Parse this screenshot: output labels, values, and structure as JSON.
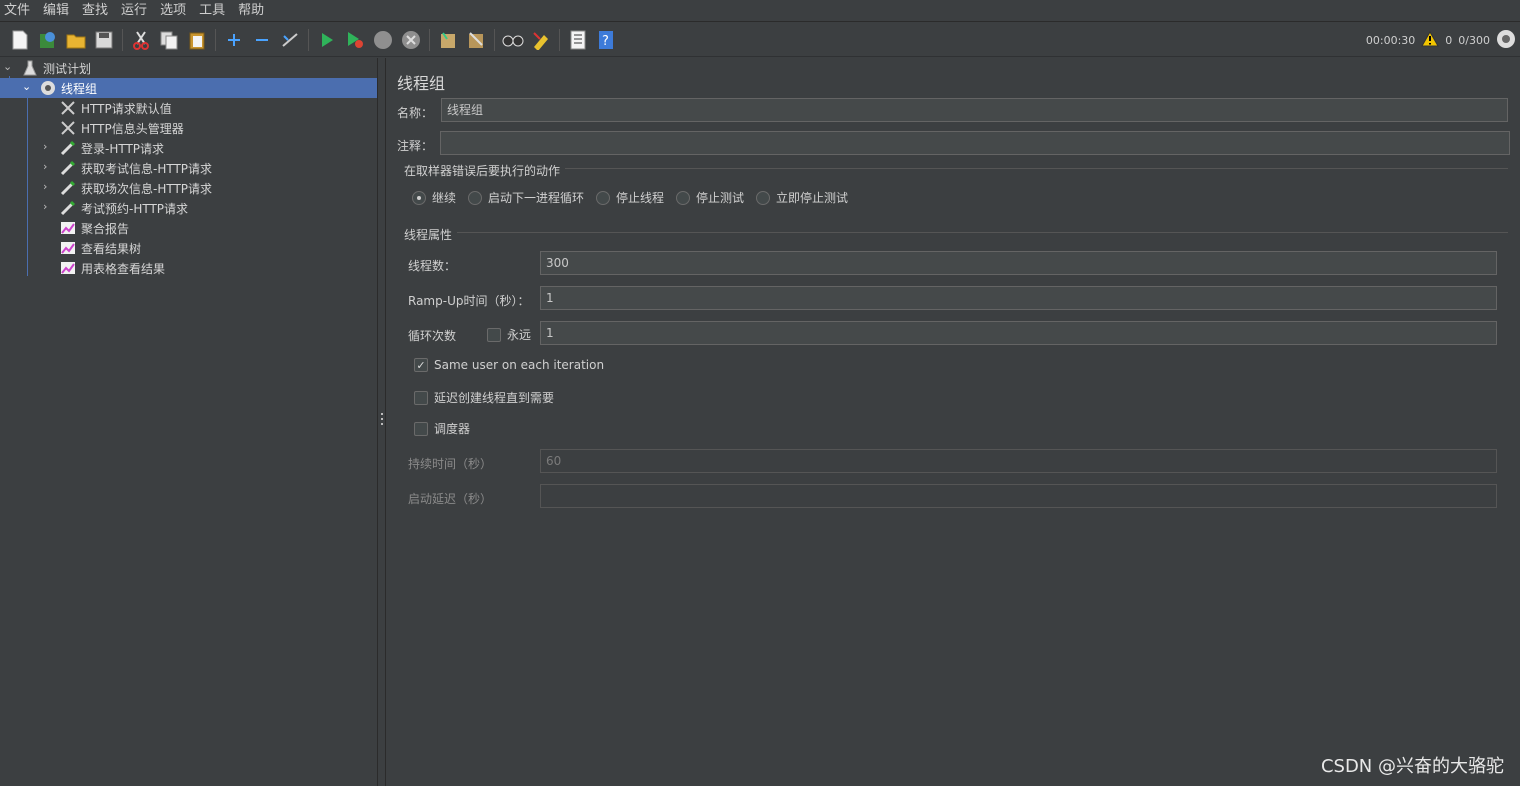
{
  "menu": [
    "文件",
    "编辑",
    "查找",
    "运行",
    "选项",
    "工具",
    "帮助"
  ],
  "status": {
    "elapsed": "00:00:30",
    "warnings": "0",
    "threads": "0/300"
  },
  "tree": {
    "root": "测试计划",
    "group": "线程组",
    "children": [
      "HTTP请求默认值",
      "HTTP信息头管理器",
      "登录-HTTP请求",
      "获取考试信息-HTTP请求",
      "获取场次信息-HTTP请求",
      "考试预约-HTTP请求",
      "聚合报告",
      "查看结果树",
      "用表格查看结果"
    ]
  },
  "panel": {
    "title": "线程组",
    "name_label": "名称：",
    "name_value": "线程组",
    "comment_label": "注释：",
    "comment_value": "",
    "error_section": "在取样器错误后要执行的动作",
    "error_options": [
      "继续",
      "启动下一进程循环",
      "停止线程",
      "停止测试",
      "立即停止测试"
    ],
    "props_section": "线程属性",
    "threads_label": "线程数：",
    "threads_value": "300",
    "rampup_label": "Ramp-Up时间（秒）：",
    "rampup_value": "1",
    "loop_label": "循环次数",
    "forever_label": "永远",
    "loop_value": "1",
    "same_user_label": "Same user on each iteration",
    "delay_label": "延迟创建线程直到需要",
    "scheduler_label": "调度器",
    "duration_label": "持续时间（秒）",
    "duration_value": "60",
    "startup_label": "启动延迟（秒）",
    "startup_value": ""
  },
  "watermark": "CSDN @兴奋的大骆驼"
}
